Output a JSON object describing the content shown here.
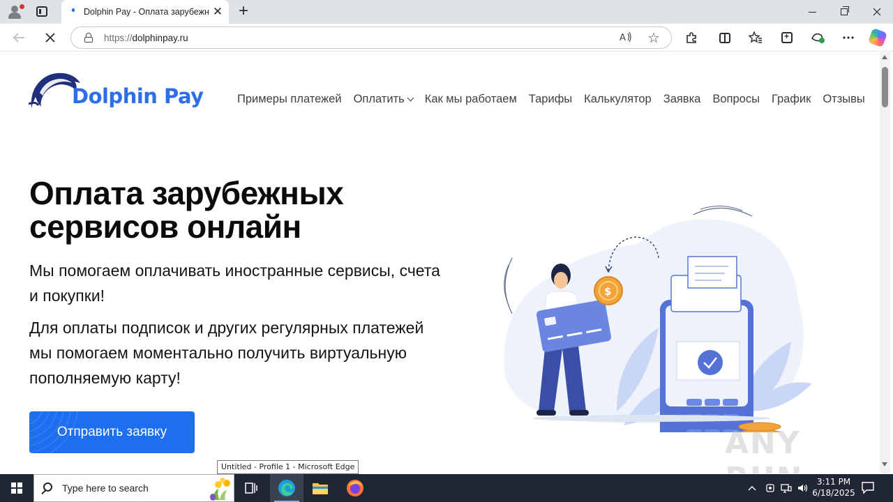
{
  "browser": {
    "tab_title": "Dolphin Pay - Оплата зарубежны",
    "new_tab_glyph": "+",
    "close_glyph": "✕",
    "url_protocol": "https://",
    "url_host": "dolphinpay.ru",
    "icons": [
      "profile-icon",
      "tab-actions-icon",
      "back-icon",
      "stop-loading-icon",
      "lock-icon",
      "read-aloud-icon",
      "favorite-star-icon",
      "extensions-icon",
      "split-screen-icon",
      "favorites-icon",
      "collections-icon",
      "performance-icon",
      "more-icon",
      "copilot-icon"
    ]
  },
  "site": {
    "logo_text": "Dolphin Pay",
    "brand_color": "#2c6fe8",
    "nav": [
      {
        "label": "Примеры платежей"
      },
      {
        "label": "Оплатить",
        "has_dropdown": true
      },
      {
        "label": "Как мы работаем"
      },
      {
        "label": "Тарифы"
      },
      {
        "label": "Калькулятор"
      },
      {
        "label": "Заявка"
      },
      {
        "label": "Вопросы"
      },
      {
        "label": "График"
      },
      {
        "label": "Отзывы"
      }
    ],
    "hero": {
      "title_line1": "Оплата зарубежных",
      "title_line2": "сервисов онлайн",
      "p1": "Мы помогаем оплачивать иностранные сервисы, счета и покупки!",
      "p2": "Для оплаты подписок и других регулярных платежей мы помогаем моментально получить виртуальную пополняемую карту!",
      "cta_label": "Отправить заявку",
      "cta_color": "#1e6ff0"
    }
  },
  "watermark": "ANY RUN",
  "tooltip": "Untitled - Profile 1 - Microsoft Edge",
  "taskbar": {
    "search_placeholder": "Type here to search",
    "time": "3:11 PM",
    "date": "6/18/2025",
    "apps": [
      "task-view-icon",
      "edge-icon",
      "file-explorer-icon",
      "firefox-icon"
    ]
  }
}
